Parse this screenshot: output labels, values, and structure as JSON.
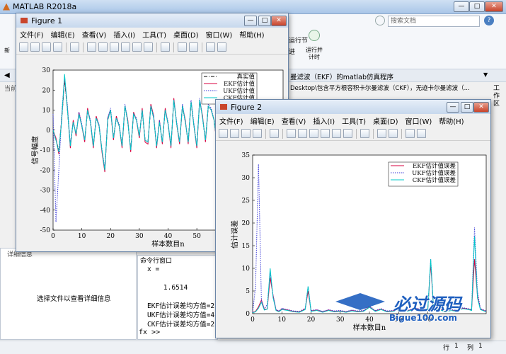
{
  "main": {
    "title": "MATLAB R2018a",
    "search_placeholder": "搜索文档",
    "run_section": "运行节",
    "run_time": "运行并\n计时",
    "next": "进",
    "tab_left": "当前",
    "editor_file": "曼滤波（EKF）的matlab仿真程序",
    "path": "Desktop\\包含平方根容积卡尔曼滤波（CKF），无迹卡尔曼滤波（...",
    "workspace": "工作区",
    "details_title": "详细信息",
    "details_msg": "选择文件以查看详细信息",
    "cmd_title": "命令行窗口",
    "cmd_lines": [
      "x =",
      "",
      "    1.6514",
      "",
      "EKF估计误差均方值=2.(",
      "UKF估计误差均方值=4.(",
      "CKF估计误差均方值=2.("
    ],
    "prompt": "fx >>",
    "status_row": "行",
    "status_row_val": "1",
    "status_col": "列",
    "status_col_val": "1"
  },
  "fig1": {
    "title": "Figure 1",
    "menu": [
      "文件(F)",
      "编辑(E)",
      "查看(V)",
      "插入(I)",
      "工具(T)",
      "桌面(D)",
      "窗口(W)",
      "帮助(H)"
    ]
  },
  "fig2": {
    "title": "Figure 2",
    "menu": [
      "文件(F)",
      "编辑(E)",
      "查看(V)",
      "插入(I)",
      "工具(T)",
      "桌面(D)",
      "窗口(W)",
      "帮助(H)"
    ]
  },
  "watermark": {
    "text": "必过源码",
    "url": "Bigue100.com"
  },
  "chart_data": [
    {
      "type": "line",
      "xlabel": "样本数目n",
      "ylabel": "信号幅度",
      "xlim": [
        0,
        80
      ],
      "ylim": [
        -50,
        30
      ],
      "xticks": [
        0,
        10,
        20,
        30,
        40,
        50,
        60,
        70
      ],
      "yticks": [
        30,
        20,
        10,
        0,
        -10,
        -20,
        -30,
        -40,
        -50
      ],
      "series": [
        {
          "name": "真实值",
          "color": "#000000",
          "style": "dashdot",
          "x": [
            0,
            1,
            2,
            3,
            4,
            5,
            6,
            7,
            8,
            9,
            10,
            11,
            12,
            13,
            14,
            15,
            16,
            17,
            18,
            19,
            20,
            21,
            22,
            23,
            24,
            25,
            26,
            27,
            28,
            29,
            30,
            31,
            32,
            33,
            34,
            35,
            36,
            37,
            38,
            39,
            40,
            41,
            42,
            43,
            44,
            45,
            46,
            47,
            48,
            49,
            50,
            51,
            52,
            53,
            54,
            55,
            56,
            57,
            58,
            59,
            60,
            61,
            62,
            63,
            64,
            65,
            66,
            67,
            68,
            69,
            70,
            71,
            72,
            73,
            74,
            75,
            76,
            77,
            78,
            79,
            80
          ],
          "values": [
            0,
            -5,
            -10,
            5,
            25,
            10,
            -8,
            4,
            -2,
            8,
            2,
            -5,
            10,
            4,
            -8,
            6,
            2,
            -10,
            -20,
            5,
            10,
            -4,
            6,
            2,
            -8,
            12,
            4,
            -10,
            8,
            5,
            -3,
            10,
            -5,
            -6,
            12,
            6,
            -8,
            4,
            -6,
            10,
            3,
            -8,
            15,
            3,
            -6,
            12,
            4,
            -6,
            14,
            2,
            -8,
            15,
            6,
            -5,
            12,
            10,
            5,
            -6,
            12,
            22,
            14,
            -5,
            -10,
            10,
            4,
            -6,
            12,
            2,
            -8,
            8,
            6,
            -4,
            10,
            4,
            -8,
            6,
            -4,
            8,
            -5,
            4,
            0
          ]
        },
        {
          "name": "EKF估计值",
          "color": "#d9003f",
          "style": "solid",
          "x": [
            0,
            1,
            2,
            3,
            4,
            5,
            6,
            7,
            8,
            9,
            10,
            11,
            12,
            13,
            14,
            15,
            16,
            17,
            18,
            19,
            20,
            21,
            22,
            23,
            24,
            25,
            26,
            27,
            28,
            29,
            30,
            31,
            32,
            33,
            34,
            35,
            36,
            37,
            38,
            39,
            40,
            41,
            42,
            43,
            44,
            45,
            46,
            47,
            48,
            49,
            50,
            51,
            52,
            53,
            54,
            55,
            56,
            57,
            58,
            59,
            60,
            61,
            62,
            63,
            64,
            65,
            66,
            67,
            68,
            69,
            70,
            71,
            72,
            73,
            74,
            75,
            76,
            77,
            78,
            79,
            80
          ],
          "values": [
            0,
            -4,
            -12,
            6,
            26,
            11,
            -9,
            5,
            -3,
            9,
            2,
            -6,
            11,
            4,
            -9,
            7,
            2,
            -11,
            -21,
            6,
            10,
            -5,
            7,
            2,
            -9,
            12,
            5,
            -11,
            9,
            5,
            -4,
            11,
            -6,
            -7,
            13,
            7,
            -9,
            5,
            -7,
            11,
            3,
            -9,
            16,
            3,
            -7,
            12,
            5,
            -7,
            14,
            2,
            -9,
            15,
            7,
            -6,
            12,
            10,
            5,
            -7,
            12,
            23,
            15,
            -6,
            -11,
            10,
            4,
            -7,
            13,
            2,
            -9,
            8,
            7,
            -5,
            10,
            4,
            -9,
            7,
            -5,
            8,
            -6,
            4,
            0
          ]
        },
        {
          "name": "UKF估计值",
          "color": "#3a3ad8",
          "style": "dotted",
          "x": [
            0,
            1,
            2,
            3,
            4,
            5,
            6,
            7,
            8,
            9,
            10,
            11,
            12,
            13,
            14,
            15,
            16,
            17,
            18,
            19,
            20,
            21,
            22,
            23,
            24,
            25,
            26,
            27,
            28,
            29,
            30,
            31,
            32,
            33,
            34,
            35,
            36,
            37,
            38,
            39,
            40,
            41,
            42,
            43,
            44,
            45,
            46,
            47,
            48,
            49,
            50,
            51,
            52,
            53,
            54,
            55,
            56,
            57,
            58,
            59,
            60,
            61,
            62,
            63,
            64,
            65,
            66,
            67,
            68,
            69,
            70,
            71,
            72,
            73,
            74,
            75,
            76,
            77,
            78,
            79,
            80
          ],
          "values": [
            8,
            -46,
            -20,
            8,
            27,
            12,
            -7,
            4,
            -2,
            9,
            3,
            -5,
            10,
            5,
            -8,
            6,
            3,
            -10,
            -19,
            6,
            11,
            -4,
            6,
            3,
            -8,
            13,
            4,
            -10,
            8,
            6,
            -3,
            10,
            -5,
            -6,
            12,
            7,
            -8,
            5,
            -6,
            10,
            4,
            -8,
            15,
            4,
            -6,
            13,
            4,
            -6,
            15,
            3,
            -8,
            16,
            6,
            -5,
            13,
            11,
            5,
            -6,
            13,
            24,
            14,
            -5,
            -10,
            11,
            5,
            -6,
            12,
            3,
            -8,
            9,
            6,
            -4,
            11,
            4,
            -8,
            6,
            -4,
            9,
            -5,
            5,
            0
          ]
        },
        {
          "name": "CKF估计值",
          "color": "#00c8c8",
          "style": "solid",
          "x": [
            0,
            1,
            2,
            3,
            4,
            5,
            6,
            7,
            8,
            9,
            10,
            11,
            12,
            13,
            14,
            15,
            16,
            17,
            18,
            19,
            20,
            21,
            22,
            23,
            24,
            25,
            26,
            27,
            28,
            29,
            30,
            31,
            32,
            33,
            34,
            35,
            36,
            37,
            38,
            39,
            40,
            41,
            42,
            43,
            44,
            45,
            46,
            47,
            48,
            49,
            50,
            51,
            52,
            53,
            54,
            55,
            56,
            57,
            58,
            59,
            60,
            61,
            62,
            63,
            64,
            65,
            66,
            67,
            68,
            69,
            70,
            71,
            72,
            73,
            74,
            75,
            76,
            77,
            78,
            79,
            80
          ],
          "values": [
            0,
            -5,
            -11,
            5,
            28,
            10,
            -8,
            4,
            -2,
            8,
            2,
            -5,
            10,
            4,
            -8,
            6,
            2,
            -10,
            -20,
            5,
            10,
            -4,
            6,
            2,
            -8,
            12,
            4,
            -10,
            8,
            5,
            -3,
            10,
            -5,
            -6,
            12,
            6,
            -8,
            4,
            -6,
            10,
            3,
            -8,
            15,
            3,
            -6,
            12,
            4,
            -6,
            14,
            2,
            -8,
            15,
            6,
            -5,
            12,
            10,
            5,
            -6,
            12,
            22,
            14,
            -5,
            -10,
            10,
            4,
            -6,
            12,
            2,
            -8,
            8,
            6,
            -4,
            10,
            4,
            -8,
            6,
            -4,
            8,
            -5,
            4,
            0
          ]
        }
      ]
    },
    {
      "type": "line",
      "xlabel": "样本数目n",
      "ylabel": "估计误差",
      "xlim": [
        0,
        80
      ],
      "ylim": [
        0,
        35
      ],
      "xticks": [
        0,
        10,
        20,
        30,
        40,
        50,
        60
      ],
      "yticks": [
        35,
        30,
        25,
        20,
        15,
        10,
        5,
        0
      ],
      "series": [
        {
          "name": "EKF估计值误差",
          "color": "#d9003f",
          "style": "solid",
          "x": [
            0,
            1,
            2,
            3,
            4,
            5,
            6,
            7,
            8,
            9,
            10,
            12,
            14,
            16,
            18,
            19,
            20,
            22,
            24,
            26,
            28,
            30,
            32,
            34,
            36,
            38,
            40,
            42,
            44,
            46,
            48,
            50,
            52,
            54,
            56,
            58,
            60,
            61,
            62,
            64,
            66,
            68,
            70,
            72,
            74,
            75,
            76,
            77,
            78,
            80
          ],
          "values": [
            0.3,
            0.5,
            1.5,
            3,
            1,
            1,
            8,
            4,
            0.8,
            0.5,
            1,
            0.8,
            0.5,
            0.4,
            1,
            5,
            0.6,
            0.8,
            0.4,
            0.8,
            0.5,
            0.6,
            0.4,
            0.7,
            0.5,
            0.6,
            1.5,
            0.6,
            1,
            0.5,
            0.6,
            0.9,
            0.5,
            0.8,
            1.2,
            0.6,
            1,
            11,
            0.8,
            1,
            0.5,
            0.8,
            0.6,
            1.2,
            1,
            0.8,
            12,
            4,
            1,
            0.5
          ]
        },
        {
          "name": "UKF估计值误差",
          "color": "#3a3ad8",
          "style": "dotted",
          "x": [
            0,
            1,
            2,
            3,
            4,
            5,
            6,
            7,
            8,
            9,
            10,
            12,
            14,
            16,
            18,
            19,
            20,
            22,
            24,
            26,
            28,
            30,
            32,
            34,
            36,
            38,
            40,
            42,
            44,
            46,
            48,
            50,
            52,
            54,
            56,
            58,
            60,
            61,
            62,
            64,
            66,
            68,
            70,
            72,
            74,
            75,
            76,
            77,
            78,
            80
          ],
          "values": [
            0.3,
            6,
            33,
            3,
            1,
            2,
            9,
            4,
            1,
            0.6,
            1.2,
            0.9,
            0.6,
            0.5,
            1.2,
            6,
            0.7,
            0.9,
            0.5,
            0.9,
            0.6,
            0.7,
            0.5,
            0.8,
            0.6,
            0.7,
            1.7,
            0.7,
            1.1,
            0.6,
            0.7,
            1,
            0.6,
            0.9,
            1.3,
            0.7,
            1.1,
            12,
            0.9,
            1.1,
            0.6,
            0.9,
            0.7,
            1.3,
            1.1,
            0.9,
            19,
            5,
            1.1,
            0.6
          ]
        },
        {
          "name": "CKF估计值误差",
          "color": "#00c8c8",
          "style": "solid",
          "x": [
            0,
            1,
            2,
            3,
            4,
            5,
            6,
            7,
            8,
            9,
            10,
            12,
            14,
            16,
            18,
            19,
            20,
            22,
            24,
            26,
            28,
            30,
            32,
            34,
            36,
            38,
            40,
            42,
            44,
            46,
            48,
            50,
            52,
            54,
            56,
            58,
            60,
            61,
            62,
            64,
            66,
            68,
            70,
            72,
            74,
            75,
            76,
            77,
            78,
            80
          ],
          "values": [
            0.2,
            0.4,
            1.2,
            2.5,
            0.8,
            1,
            10,
            3.5,
            0.7,
            0.4,
            0.9,
            0.7,
            0.4,
            0.3,
            0.9,
            6,
            0.5,
            0.7,
            0.3,
            0.7,
            0.4,
            0.5,
            0.3,
            0.6,
            0.4,
            0.5,
            1.4,
            0.5,
            0.9,
            0.4,
            0.5,
            0.8,
            0.4,
            0.7,
            1.1,
            0.5,
            0.9,
            12,
            0.7,
            0.9,
            0.4,
            0.7,
            0.5,
            1.1,
            0.9,
            0.7,
            17,
            3.5,
            0.9,
            0.4
          ]
        }
      ]
    }
  ]
}
